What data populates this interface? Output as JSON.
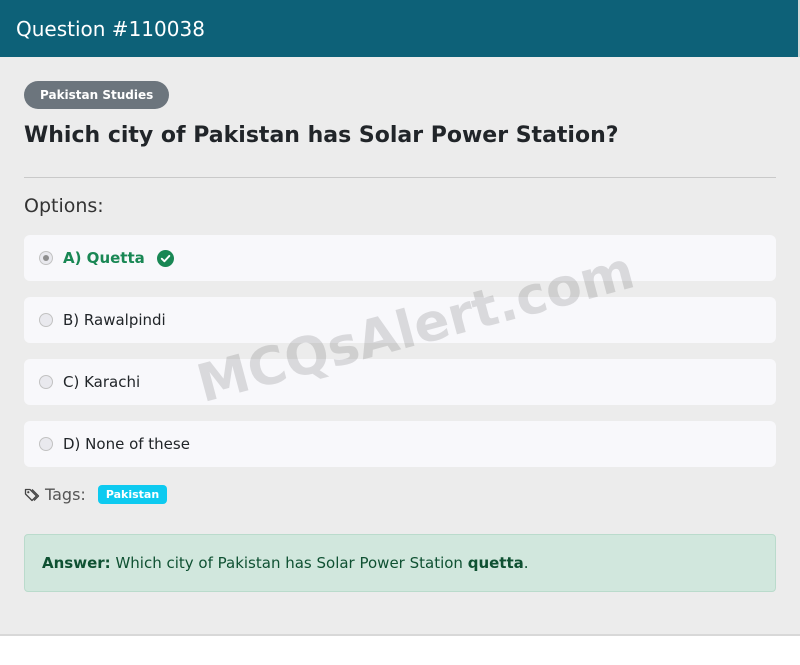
{
  "header": {
    "title": "Question #110038"
  },
  "question": {
    "category": "Pakistan Studies",
    "text": "Which city of Pakistan has Solar Power Station?",
    "options_label": "Options:",
    "options": [
      {
        "label": "A) Quetta",
        "correct": true
      },
      {
        "label": "B) Rawalpindi",
        "correct": false
      },
      {
        "label": "C) Karachi",
        "correct": false
      },
      {
        "label": "D) None of these",
        "correct": false
      }
    ]
  },
  "tags": {
    "label": "Tags:",
    "items": [
      "Pakistan"
    ]
  },
  "answer": {
    "prefix": "Answer:",
    "text": "Which city of Pakistan has Solar Power Station",
    "value": "quetta",
    "suffix": "."
  },
  "watermark": "MCQsAlert.com",
  "colors": {
    "header_bg": "#0d6178",
    "correct": "#198754",
    "tag": "#0dcaf0",
    "answer_bg": "#d1e7dd"
  }
}
